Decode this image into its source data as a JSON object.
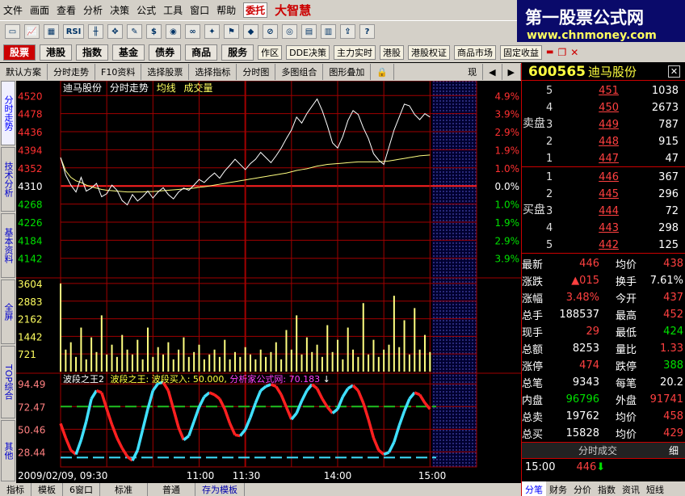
{
  "menu": [
    "文件",
    "画面",
    "查看",
    "分析",
    "决策",
    "公式",
    "工具",
    "窗口",
    "帮助"
  ],
  "menu_extra": "委托",
  "brand": "大智慧",
  "toolbar_icons": [
    "open-icon",
    "chart-icon",
    "grid-icon",
    "rsi-icon",
    "k-line-icon",
    "move-icon",
    "draw-icon",
    "dollar-icon",
    "eye-icon",
    "binoculars-icon",
    "fire-icon",
    "alert-icon",
    "diamond-icon",
    "no-entry-icon",
    "web-icon",
    "window-icon",
    "book-icon",
    "export-icon",
    "help-icon"
  ],
  "toolbar_text": {
    "rsi": "RSI",
    "help": "?"
  },
  "main_buttons": [
    "股票",
    "港股",
    "指数",
    "基金",
    "债券",
    "商品",
    "服务"
  ],
  "sub_buttons": [
    "作区",
    "DDE决策",
    "主力实时",
    "港股",
    "港股权证",
    "商品市场",
    "固定收益"
  ],
  "watermark": {
    "title": "第一股票公式网",
    "url": "www.chnmoney.com"
  },
  "window_controls": [
    "▬",
    "❐",
    "✕"
  ],
  "tabs": [
    "默认方案",
    "分时走势",
    "F10资料",
    "选择股票",
    "选择指标",
    "分时图",
    "多图组合",
    "图形叠加"
  ],
  "tab_right": "现",
  "sidebar_tabs": [
    "分时走势",
    "技术分析",
    "基本资料",
    "全屏",
    "TOP综合",
    "其他"
  ],
  "chart_data": {
    "type": "line",
    "title": "迪马股份",
    "header_items": [
      "迪马股份",
      "分时走势",
      "均线",
      "成交量"
    ],
    "y_prices": [
      4520,
      4478,
      4436,
      4394,
      4352,
      4310,
      4268,
      4226,
      4184,
      4142
    ],
    "y_pcts": [
      "4.9%",
      "3.9%",
      "2.9%",
      "1.9%",
      "1.0%",
      "0.0%",
      "1.0%",
      "1.9%",
      "2.9%",
      "3.9%"
    ],
    "prev_close": 4310,
    "x_ticks": [
      "2009/02/09, 09:30",
      "11:00",
      "11:30",
      "14:00",
      "15:00"
    ],
    "price": [
      4376,
      4335,
      4312,
      4296,
      4330,
      4298,
      4305,
      4316,
      4285,
      4292,
      4312,
      4300,
      4276,
      4266,
      4290,
      4275,
      4285,
      4298,
      4282,
      4296,
      4306,
      4290,
      4280,
      4296,
      4305,
      4300,
      4312,
      4325,
      4318,
      4330,
      4340,
      4328,
      4345,
      4358,
      4372,
      4360,
      4348,
      4362,
      4372,
      4388,
      4376,
      4364,
      4380,
      4398,
      4420,
      4440,
      4470,
      4456,
      4478,
      4495,
      4512,
      4485,
      4450,
      4410,
      4398,
      4425,
      4462,
      4485,
      4476,
      4445,
      4420,
      4385,
      4370,
      4360,
      4400,
      4440,
      4470,
      4500,
      4496,
      4476,
      4464,
      4478,
      4470
    ],
    "avg_price": [
      4376,
      4345,
      4330,
      4322,
      4318,
      4312,
      4308,
      4305,
      4302,
      4300,
      4299,
      4298,
      4297,
      4296,
      4296,
      4296,
      4296,
      4297,
      4297,
      4298,
      4299,
      4300,
      4301,
      4302,
      4303,
      4304,
      4305,
      4307,
      4308,
      4310,
      4312,
      4314,
      4316,
      4318,
      4320,
      4322,
      4324,
      4326,
      4328,
      4330,
      4332,
      4334,
      4336,
      4338,
      4340,
      4343,
      4346,
      4348,
      4350,
      4353,
      4356,
      4358,
      4360,
      4361,
      4362,
      4363,
      4364,
      4365,
      4366,
      4366,
      4366,
      4366,
      4366,
      4367,
      4368,
      4370,
      4372,
      4374,
      4376,
      4378,
      4380,
      4381,
      4382
    ],
    "vol_ticks": [
      3604,
      2883,
      2162,
      1442,
      721
    ],
    "volume": [
      3604,
      900,
      1200,
      600,
      1800,
      500,
      1400,
      800,
      2300,
      700,
      1100,
      600,
      1500,
      900,
      700,
      1300,
      500,
      1800,
      600,
      1000,
      700,
      1200,
      500,
      900,
      1400,
      600,
      800,
      1100,
      500,
      700,
      900,
      600,
      1300,
      500,
      800,
      600,
      1000,
      700,
      500,
      900,
      600,
      800,
      1200,
      500,
      1700,
      900,
      2300,
      700,
      1400,
      800,
      1100,
      600,
      1900,
      800,
      1300,
      500,
      1800,
      900,
      600,
      2800,
      700,
      1300,
      600,
      900,
      1100,
      3100,
      1000,
      2100,
      700,
      2600,
      900,
      1500,
      800
    ],
    "indicator": {
      "name": "波段之王2",
      "label": "波段之王: 波段买入: 50.000, ",
      "label2": "分析家公式网: 70.183",
      "arrow": "↓",
      "y_ticks": [
        "94.49",
        "72.47",
        "50.46",
        "28.44"
      ],
      "upper_line": 72.47,
      "lower_line": 23.0,
      "buy_line": 50.0,
      "values": [
        56,
        42,
        30,
        26,
        40,
        58,
        80,
        88,
        86,
        70,
        55,
        42,
        32,
        24,
        20,
        30,
        50,
        70,
        88,
        95,
        96,
        88,
        70,
        52,
        40,
        44,
        58,
        72,
        82,
        86,
        84,
        80,
        70,
        56,
        45,
        44,
        50,
        62,
        76,
        88,
        92,
        94,
        92,
        84,
        72,
        60,
        66,
        78,
        88,
        94,
        90,
        80,
        72,
        66,
        70,
        82,
        90,
        93,
        88,
        76,
        60,
        42,
        30,
        26,
        28,
        38,
        54,
        68,
        80,
        86,
        84,
        76,
        70
      ]
    }
  },
  "quote": {
    "code": "600565",
    "name": "迪马股份",
    "sell_label": "卖盘",
    "buy_label": "买盘",
    "sell": [
      {
        "lvl": "5",
        "price": "451",
        "vol": "1038"
      },
      {
        "lvl": "4",
        "price": "450",
        "vol": "2673"
      },
      {
        "lvl": "3",
        "price": "449",
        "vol": "787"
      },
      {
        "lvl": "2",
        "price": "448",
        "vol": "915"
      },
      {
        "lvl": "1",
        "price": "447",
        "vol": "47"
      }
    ],
    "buy": [
      {
        "lvl": "1",
        "price": "446",
        "vol": "367"
      },
      {
        "lvl": "2",
        "price": "445",
        "vol": "296"
      },
      {
        "lvl": "3",
        "price": "444",
        "vol": "72"
      },
      {
        "lvl": "4",
        "price": "443",
        "vol": "298"
      },
      {
        "lvl": "5",
        "price": "442",
        "vol": "125"
      }
    ],
    "stats": [
      {
        "l": "最新",
        "v": "446",
        "c": "red",
        "l2": "均价",
        "v2": "438",
        "c2": "red"
      },
      {
        "l": "涨跌",
        "v": "▲015",
        "c": "red",
        "l2": "换手",
        "v2": "7.61%",
        "c2": "wht"
      },
      {
        "l": "涨幅",
        "v": "3.48%",
        "c": "red",
        "l2": "今开",
        "v2": "437",
        "c2": "red"
      },
      {
        "l": "总手",
        "v": "188537",
        "c": "wht",
        "l2": "最高",
        "v2": "452",
        "c2": "red"
      },
      {
        "l": "现手",
        "v": "29",
        "c": "red",
        "l2": "最低",
        "v2": "424",
        "c2": "grn"
      },
      {
        "l": "总额",
        "v": "8253",
        "c": "wht",
        "l2": "量比",
        "v2": "1.33",
        "c2": "red"
      },
      {
        "l": "涨停",
        "v": "474",
        "c": "red",
        "l2": "跌停",
        "v2": "388",
        "c2": "grn"
      },
      {
        "l": "总笔",
        "v": "9343",
        "c": "wht",
        "l2": "每笔",
        "v2": "20.2",
        "c2": "wht"
      },
      {
        "l": "内盘",
        "v": "96796",
        "c": "grn",
        "l2": "外盘",
        "v2": "91741",
        "c2": "red"
      },
      {
        "l": "总卖",
        "v": "19762",
        "c": "wht",
        "l2": "均价",
        "v2": "458",
        "c2": "red"
      },
      {
        "l": "总买",
        "v": "15828",
        "c": "wht",
        "l2": "均价",
        "v2": "429",
        "c2": "red"
      }
    ],
    "trade_header": "分时成交",
    "trade_btn": "细",
    "trade": {
      "time": "15:00",
      "price": "446",
      "arrow": "⬇"
    }
  },
  "right_tabs": [
    "分笔",
    "财务",
    "分价",
    "指数",
    "资讯",
    "短线"
  ],
  "bottom_tabs": [
    "指标",
    "模板",
    "6窗口",
    "标准",
    "普通",
    "存为模板"
  ],
  "colors": {
    "grid": "#a00000",
    "price": "#ffffff",
    "avg": "#ffff80",
    "vol": "#ffff80",
    "up": "#ff3030",
    "down": "#00e000",
    "ind_up": "#40e0ff",
    "ind_down": "#ff2020"
  }
}
